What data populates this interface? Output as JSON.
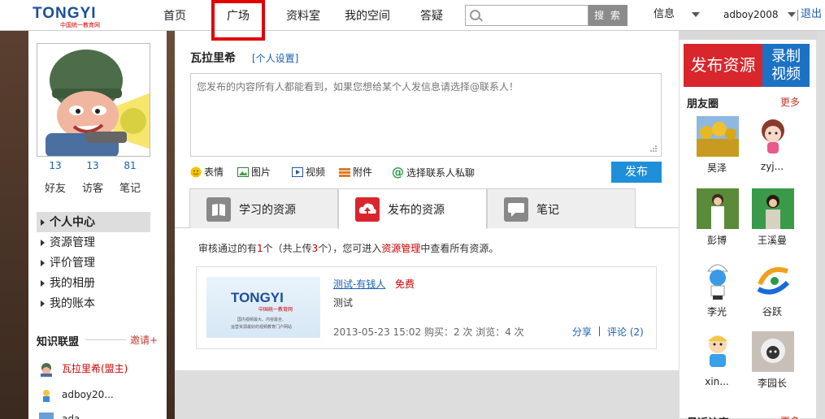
{
  "header": {
    "logo_text": "TONGYI",
    "logo_sub": "中国统一教育网",
    "nav": [
      "首页",
      "广场",
      "资料室",
      "我的空间",
      "答疑"
    ],
    "search_placeholder": "",
    "search_button": "搜 索",
    "messages": "信息",
    "username": "adboy2008",
    "logout": "退出"
  },
  "profile": {
    "stats": [
      {
        "value": "13",
        "label": "好友"
      },
      {
        "value": "13",
        "label": "访客"
      },
      {
        "value": "81",
        "label": "笔记"
      }
    ],
    "menu": [
      "个人中心",
      "资源管理",
      "评价管理",
      "我的相册",
      "我的账本"
    ]
  },
  "alliance": {
    "title": "知识联盟",
    "invite": "邀请+",
    "members": [
      "瓦拉里希(盟主)",
      "adboy20...",
      "ada"
    ]
  },
  "composer": {
    "name": "瓦拉里希",
    "settings": "[个人设置]",
    "placeholder": "您发布的内容所有人都能看到，如果您想给某个人发信息请选择@联系人！",
    "tools": [
      "表情",
      "图片",
      "视频",
      "附件",
      "选择联系人私聊"
    ],
    "publish": "发布"
  },
  "tabs": [
    "学习的资源",
    "发布的资源",
    "笔记"
  ],
  "notice": {
    "p1": "审核通过的有",
    "n1": "1",
    "p2": "个（共上传",
    "n2": "3",
    "p3": "个），您可进入",
    "link": "资源管理",
    "p4": "中查看所有资源。"
  },
  "resource": {
    "thumb_logo": "TONGYI",
    "thumb_sub": "中国统一教育网",
    "thumb_desc1": "国内视频最大、内容最全、",
    "thumb_desc2": "运营资源最好的视频教育门户网站",
    "title": "测试-有钱人",
    "price": "免费",
    "desc": "测试",
    "meta": "2013-05-23 15:02   购买：2 次   浏览：4 次",
    "share": "分享",
    "comment": "评论 (2)"
  },
  "right": {
    "publish_btn": "发布资源",
    "record_btn_1": "录制",
    "record_btn_2": "视频",
    "friends_title": "朋友圈",
    "more": "更多",
    "friends": [
      "昊泽",
      "zyj...",
      "彭博",
      "王溪曼",
      "李光",
      "谷跃",
      "xin...",
      "李园长"
    ],
    "recent_title": "最近访客"
  }
}
